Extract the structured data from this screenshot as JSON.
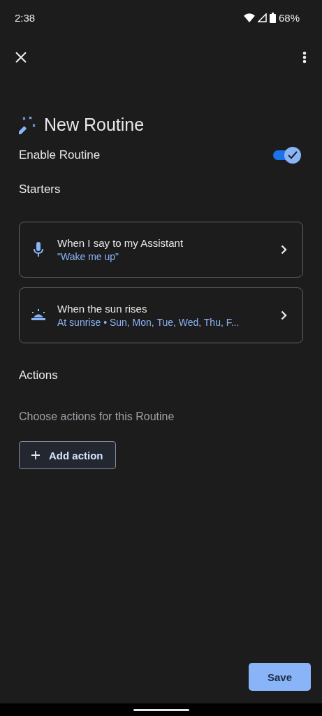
{
  "status_bar": {
    "time": "2:38",
    "battery": "68%"
  },
  "title": "New Routine",
  "enable": {
    "label": "Enable Routine",
    "on": true
  },
  "starters_heading": "Starters",
  "starters": [
    {
      "kind": "voice",
      "title": "When I say to my Assistant",
      "detail": "\"Wake me up\""
    },
    {
      "kind": "sunrise",
      "title": "When the sun rises",
      "detail": "At sunrise • Sun, Mon, Tue, Wed, Thu, F..."
    }
  ],
  "actions_heading": "Actions",
  "actions_hint": "Choose actions for this Routine",
  "add_action": "Add action",
  "save": "Save"
}
